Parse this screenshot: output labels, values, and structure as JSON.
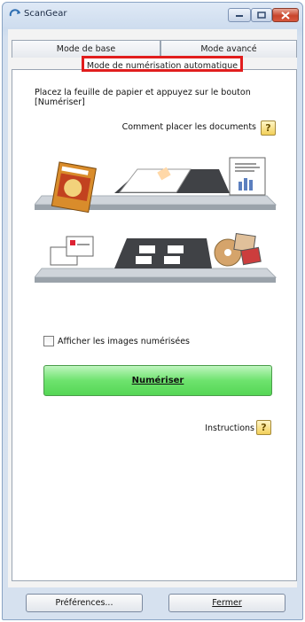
{
  "window": {
    "title": "ScanGear"
  },
  "tabs": [
    {
      "label": "Mode de base"
    },
    {
      "label": "Mode avancé"
    },
    {
      "label": "Mode de numérisation automatique"
    }
  ],
  "main": {
    "instruction": "Placez la feuille de papier et appuyez sur le bouton [Numériser]",
    "how_to_place": "Comment placer les documents",
    "show_images_checkbox": {
      "label": "Afficher les images numérisées",
      "checked": false
    },
    "scan_button": "Numériser",
    "instructions_link": "Instructions"
  },
  "footer": {
    "preferences_button": "Préférences...",
    "close_button": "Fermer"
  },
  "colors": {
    "highlight_box": "#e11d1d",
    "scan_button": "#6ee36e"
  },
  "icons": [
    "scangear-logo-icon",
    "minimize-icon",
    "maximize-icon",
    "close-icon",
    "help-icon"
  ]
}
